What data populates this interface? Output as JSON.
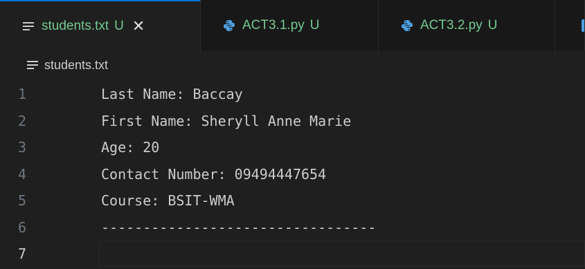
{
  "tabs": [
    {
      "label": "students.txt",
      "status": "U",
      "close": "✕",
      "icon": "text-file-icon",
      "active": true
    },
    {
      "label": "ACT3.1.py",
      "status": "U",
      "icon": "python-icon",
      "active": false
    },
    {
      "label": "ACT3.2.py",
      "status": "U",
      "icon": "python-icon",
      "active": false
    }
  ],
  "breadcrumb": {
    "file": "students.txt",
    "icon": "text-file-icon"
  },
  "lines": [
    {
      "num": "1",
      "text": "Last Name: Baccay"
    },
    {
      "num": "2",
      "text": "First Name: Sheryll Anne Marie"
    },
    {
      "num": "3",
      "text": "Age: 20"
    },
    {
      "num": "4",
      "text": "Contact Number: 09494447654"
    },
    {
      "num": "5",
      "text": "Course: BSIT-WMA"
    },
    {
      "num": "6",
      "text": "---------------------------------"
    },
    {
      "num": "7",
      "text": ""
    }
  ],
  "colors": {
    "untracked": "#73c991",
    "accent": "#0078d4",
    "python": "#4d9fe0"
  }
}
